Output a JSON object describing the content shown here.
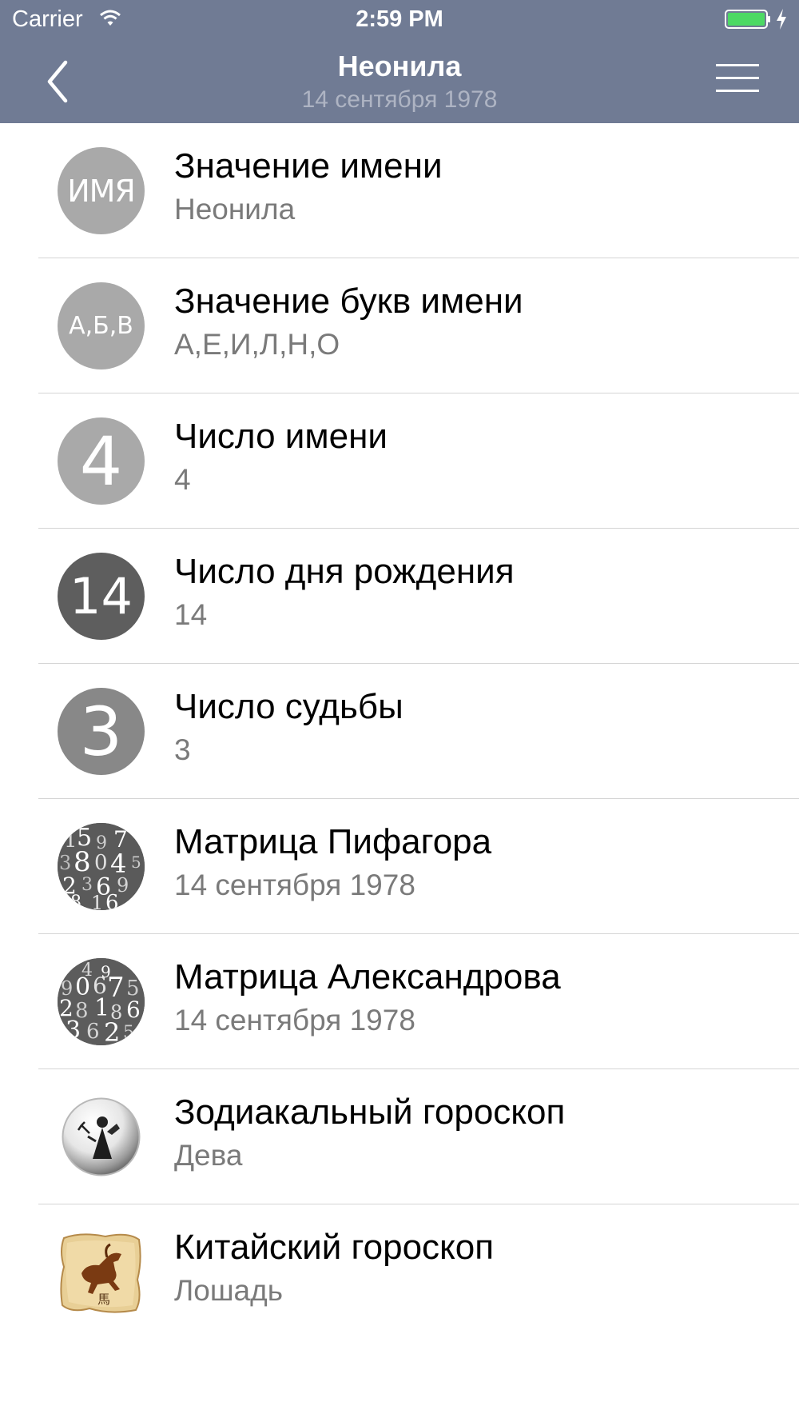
{
  "status_bar": {
    "carrier": "Carrier",
    "time": "2:59 PM"
  },
  "nav": {
    "title": "Неонила",
    "subtitle": "14 сентября 1978",
    "back_icon": "chevron-left-icon",
    "menu_icon": "hamburger-menu-icon"
  },
  "colors": {
    "nav_bg": "#707b94",
    "avatar_light": "#a9a9a9",
    "avatar_dark": "#5e5e5e",
    "avatar_mid": "#888888"
  },
  "items": [
    {
      "title": "Значение имени",
      "subtitle": "Неонила",
      "avatar_text": "ИМЯ"
    },
    {
      "title": "Значение букв имени",
      "subtitle": "А,Е,И,Л,Н,О",
      "avatar_text": "А,Б,В"
    },
    {
      "title": "Число имени",
      "subtitle": "4",
      "avatar_text": "4"
    },
    {
      "title": "Число дня рождения",
      "subtitle": "14",
      "avatar_text": "14"
    },
    {
      "title": "Число судьбы",
      "subtitle": "3",
      "avatar_text": "3"
    },
    {
      "title": "Матрица Пифагора",
      "subtitle": "14 сентября 1978",
      "avatar_icon": "numbers-collage-icon"
    },
    {
      "title": "Матрица Александрова",
      "subtitle": "14 сентября 1978",
      "avatar_icon": "numbers-collage-icon"
    },
    {
      "title": "Зодиакальный гороскоп",
      "subtitle": "Дева",
      "avatar_icon": "virgo-zodiac-icon"
    },
    {
      "title": "Китайский гороскоп",
      "subtitle": "Лошадь",
      "avatar_icon": "horse-parchment-icon"
    }
  ]
}
